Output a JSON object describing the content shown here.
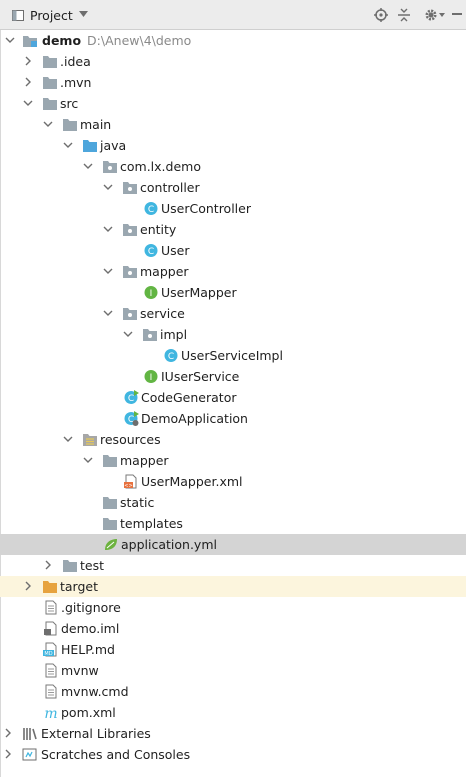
{
  "toolbar": {
    "title": "Project",
    "dropdown_icon": "chevron-down-icon",
    "icons": [
      "locate-icon",
      "collapse-all-icon",
      "settings-icon",
      "hide-icon"
    ]
  },
  "colors": {
    "folder": "#9aa7b0",
    "source_folder": "#4ea6dc",
    "resources_folder": "#a7a7a7",
    "excluded_folder": "#e7a33e",
    "class_icon": "#40b6e0",
    "interface_icon": "#62b543",
    "selected_row": "#d4d4d4",
    "excluded_row": "#fcf5dd"
  },
  "tree": {
    "demo": {
      "label": "demo",
      "path": "D:\\Anew\\4\\demo"
    },
    "idea": "idea",
    "mvn": ".mvn",
    "src": "src",
    "main": "main",
    "java": "java",
    "com_lx_demo": "com.lx.demo",
    "controller": "controller",
    "user_controller": "UserController",
    "entity": "entity",
    "user": "User",
    "mapper": "mapper",
    "user_mapper": "UserMapper",
    "service": "service",
    "impl": "impl",
    "user_service_impl": "UserServiceImpl",
    "iuser_service": "IUserService",
    "code_generator": "CodeGenerator",
    "demo_application": "DemoApplication",
    "resources": "resources",
    "res_mapper": "mapper",
    "user_mapper_xml": "UserMapper.xml",
    "static": "static",
    "templates": "templates",
    "application_yml": "application.yml",
    "test": "test",
    "target": "target",
    "gitignore": ".gitignore",
    "demo_iml": "demo.iml",
    "help_md": "HELP.md",
    "mvnw": "mvnw",
    "mvnw_cmd": "mvnw.cmd",
    "pom_xml": "pom.xml",
    "external_libraries": "External Libraries",
    "scratches": "Scratches and Consoles"
  }
}
